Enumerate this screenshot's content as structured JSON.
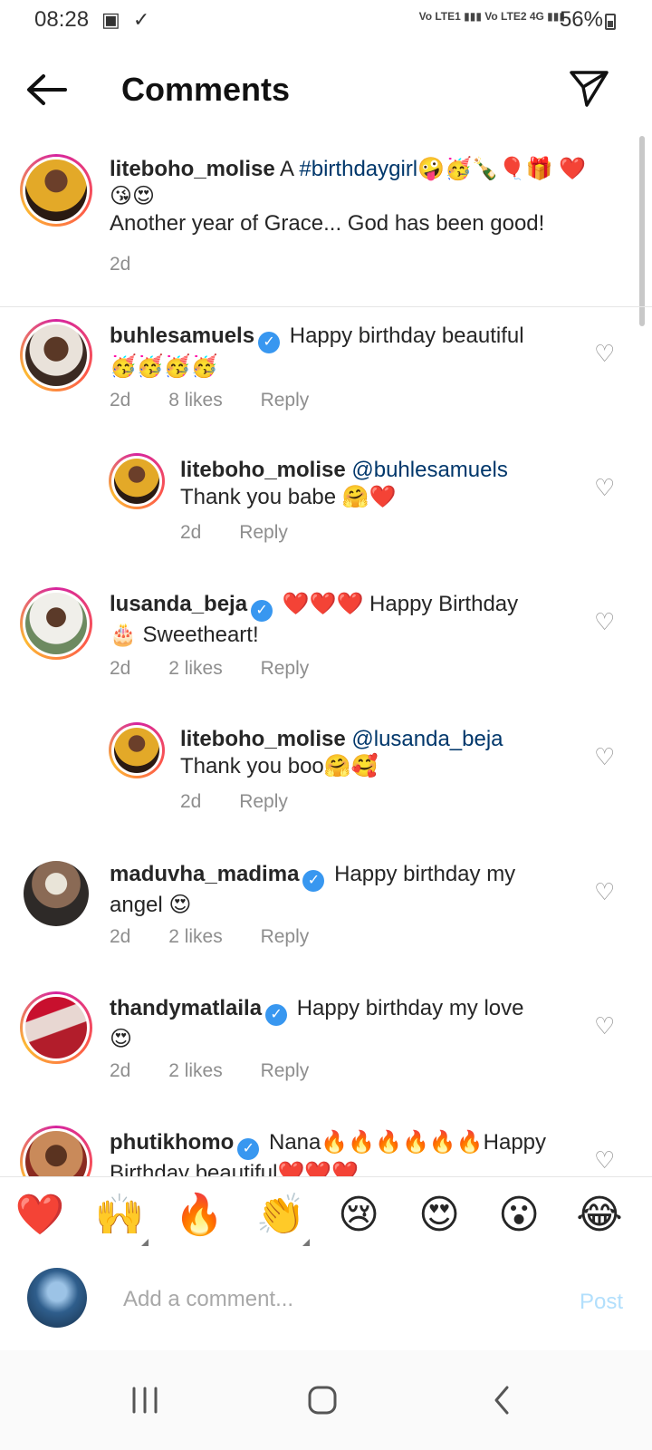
{
  "status_bar": {
    "time": "08:28",
    "left_icons": "▣ ✓",
    "network": "Vo LTE1 ▮▮▮ Vo LTE2 4G ▮▮▮",
    "battery": "56%"
  },
  "header": {
    "title": "Comments"
  },
  "caption": {
    "username": "liteboho_molise",
    "text_prefix": "A ",
    "hashtag": "#birthdaygirl",
    "emojis": "🤪🥳🍾🎈🎁 ❤️😘😍",
    "text_line2": "Another year of Grace... God has been good!",
    "time": "2d"
  },
  "comments": [
    {
      "username": "buhlesamuels",
      "mention": "",
      "text": "Happy birthday beautiful",
      "text2": "🥳🥳🥳🥳",
      "time": "2d",
      "likes": "8 likes",
      "reply_label": "Reply"
    },
    {
      "username": "liteboho_molise",
      "mention": "@buhlesamuels",
      "text": "",
      "text2": "Thank you babe 🤗❤️",
      "time": "2d",
      "likes": "",
      "reply_label": "Reply"
    },
    {
      "username": "lusanda_beja",
      "mention": "",
      "text": "❤️❤️❤️ Happy Birthday",
      "text2": "🎂 Sweetheart!",
      "time": "2d",
      "likes": "2 likes",
      "reply_label": "Reply"
    },
    {
      "username": "liteboho_molise",
      "mention": "@lusanda_beja",
      "text": "",
      "text2": "Thank you boo🤗🥰",
      "time": "2d",
      "likes": "",
      "reply_label": "Reply"
    },
    {
      "username": "maduvha_madima",
      "mention": "",
      "text": "Happy birthday my",
      "text2": "angel 😍",
      "time": "2d",
      "likes": "2 likes",
      "reply_label": "Reply"
    },
    {
      "username": "thandymatlaila",
      "mention": "",
      "text": "Happy birthday my love",
      "text2": "😍",
      "time": "2d",
      "likes": "2 likes",
      "reply_label": "Reply"
    },
    {
      "username": "phutikhomo",
      "mention": "",
      "text": "Nana🔥🔥🔥🔥🔥🔥Happy",
      "text2": "Birthday beautiful❤️❤️❤️",
      "time": "",
      "likes": "",
      "reply_label": ""
    }
  ],
  "quick_emojis": [
    "❤️",
    "🙌",
    "🔥",
    "👏",
    "😢",
    "😍",
    "😮",
    "😂"
  ],
  "composer": {
    "placeholder": "Add a comment...",
    "post_label": "Post"
  },
  "icons": {
    "back": "arrow-left-icon",
    "share": "paper-plane-icon",
    "like": "heart-outline-icon",
    "verified": "verified-badge-icon"
  },
  "colors": {
    "link": "#00376b",
    "verified": "#3897f0",
    "post_disabled": "#b2dffc",
    "meta": "#8e8e8e"
  }
}
